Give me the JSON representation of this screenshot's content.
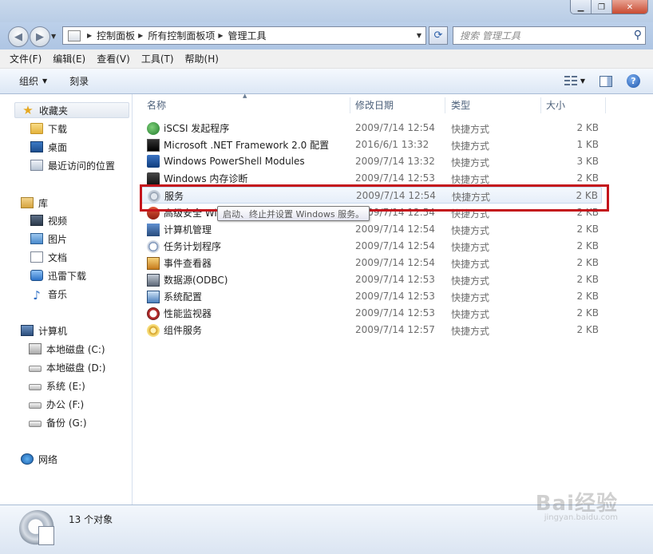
{
  "window": {
    "minimize_label": "▁",
    "restore_label": "❐",
    "close_label": "✕"
  },
  "address": {
    "crumbs": [
      "控制面板",
      "所有控制面板项",
      "管理工具"
    ],
    "search_placeholder": "搜索 管理工具"
  },
  "menu": [
    "文件(F)",
    "编辑(E)",
    "查看(V)",
    "工具(T)",
    "帮助(H)"
  ],
  "commands": {
    "organize": "组织",
    "burn": "刻录"
  },
  "nav": {
    "favorites": "收藏夹",
    "downloads": "下载",
    "desktop": "桌面",
    "recent": "最近访问的位置",
    "libraries": "库",
    "videos": "视频",
    "pictures": "图片",
    "documents": "文档",
    "xunlei": "迅雷下载",
    "music": "音乐",
    "computer": "计算机",
    "drive_c": "本地磁盘 (C:)",
    "drive_d": "本地磁盘 (D:)",
    "drive_e": "系统 (E:)",
    "drive_f": "办公 (F:)",
    "drive_g": "备份 (G:)",
    "network": "网络"
  },
  "columns": {
    "name": "名称",
    "date": "修改日期",
    "type": "类型",
    "size": "大小"
  },
  "files": [
    {
      "name": "iSCSI 发起程序",
      "date": "2009/7/14 12:54",
      "type": "快捷方式",
      "size": "2 KB",
      "icon": "iscsi-icon"
    },
    {
      "name": "Microsoft .NET Framework 2.0 配置",
      "date": "2016/6/1 13:32",
      "type": "快捷方式",
      "size": "1 KB",
      "icon": "dotnet-icon"
    },
    {
      "name": "Windows PowerShell Modules",
      "date": "2009/7/14 13:32",
      "type": "快捷方式",
      "size": "3 KB",
      "icon": "powershell-icon"
    },
    {
      "name": "Windows 内存诊断",
      "date": "2009/7/14 12:53",
      "type": "快捷方式",
      "size": "2 KB",
      "icon": "memory-diagnostic-icon"
    },
    {
      "name": "服务",
      "date": "2009/7/14 12:54",
      "type": "快捷方式",
      "size": "2 KB",
      "icon": "services-icon"
    },
    {
      "name": "高级安全 Wi",
      "date": "2009/7/14 12:54",
      "type": "快捷方式",
      "size": "2 KB",
      "icon": "firewall-icon"
    },
    {
      "name": "计算机管理",
      "date": "2009/7/14 12:54",
      "type": "快捷方式",
      "size": "2 KB",
      "icon": "computer-management-icon"
    },
    {
      "name": "任务计划程序",
      "date": "2009/7/14 12:54",
      "type": "快捷方式",
      "size": "2 KB",
      "icon": "task-scheduler-icon"
    },
    {
      "name": "事件查看器",
      "date": "2009/7/14 12:54",
      "type": "快捷方式",
      "size": "2 KB",
      "icon": "event-viewer-icon"
    },
    {
      "name": "数据源(ODBC)",
      "date": "2009/7/14 12:53",
      "type": "快捷方式",
      "size": "2 KB",
      "icon": "odbc-icon"
    },
    {
      "name": "系统配置",
      "date": "2009/7/14 12:53",
      "type": "快捷方式",
      "size": "2 KB",
      "icon": "system-config-icon"
    },
    {
      "name": "性能监视器",
      "date": "2009/7/14 12:53",
      "type": "快捷方式",
      "size": "2 KB",
      "icon": "performance-monitor-icon"
    },
    {
      "name": "组件服务",
      "date": "2009/7/14 12:57",
      "type": "快捷方式",
      "size": "2 KB",
      "icon": "component-services-icon"
    }
  ],
  "tooltip": "启动、终止并设置 Windows 服务。",
  "status": {
    "count": "13 个对象"
  },
  "watermark": {
    "brand": "Bai经验",
    "url": "jingyan.baidu.com"
  },
  "colors": {
    "highlight_box": "#c4141c",
    "accent": "#2a5ea8"
  }
}
